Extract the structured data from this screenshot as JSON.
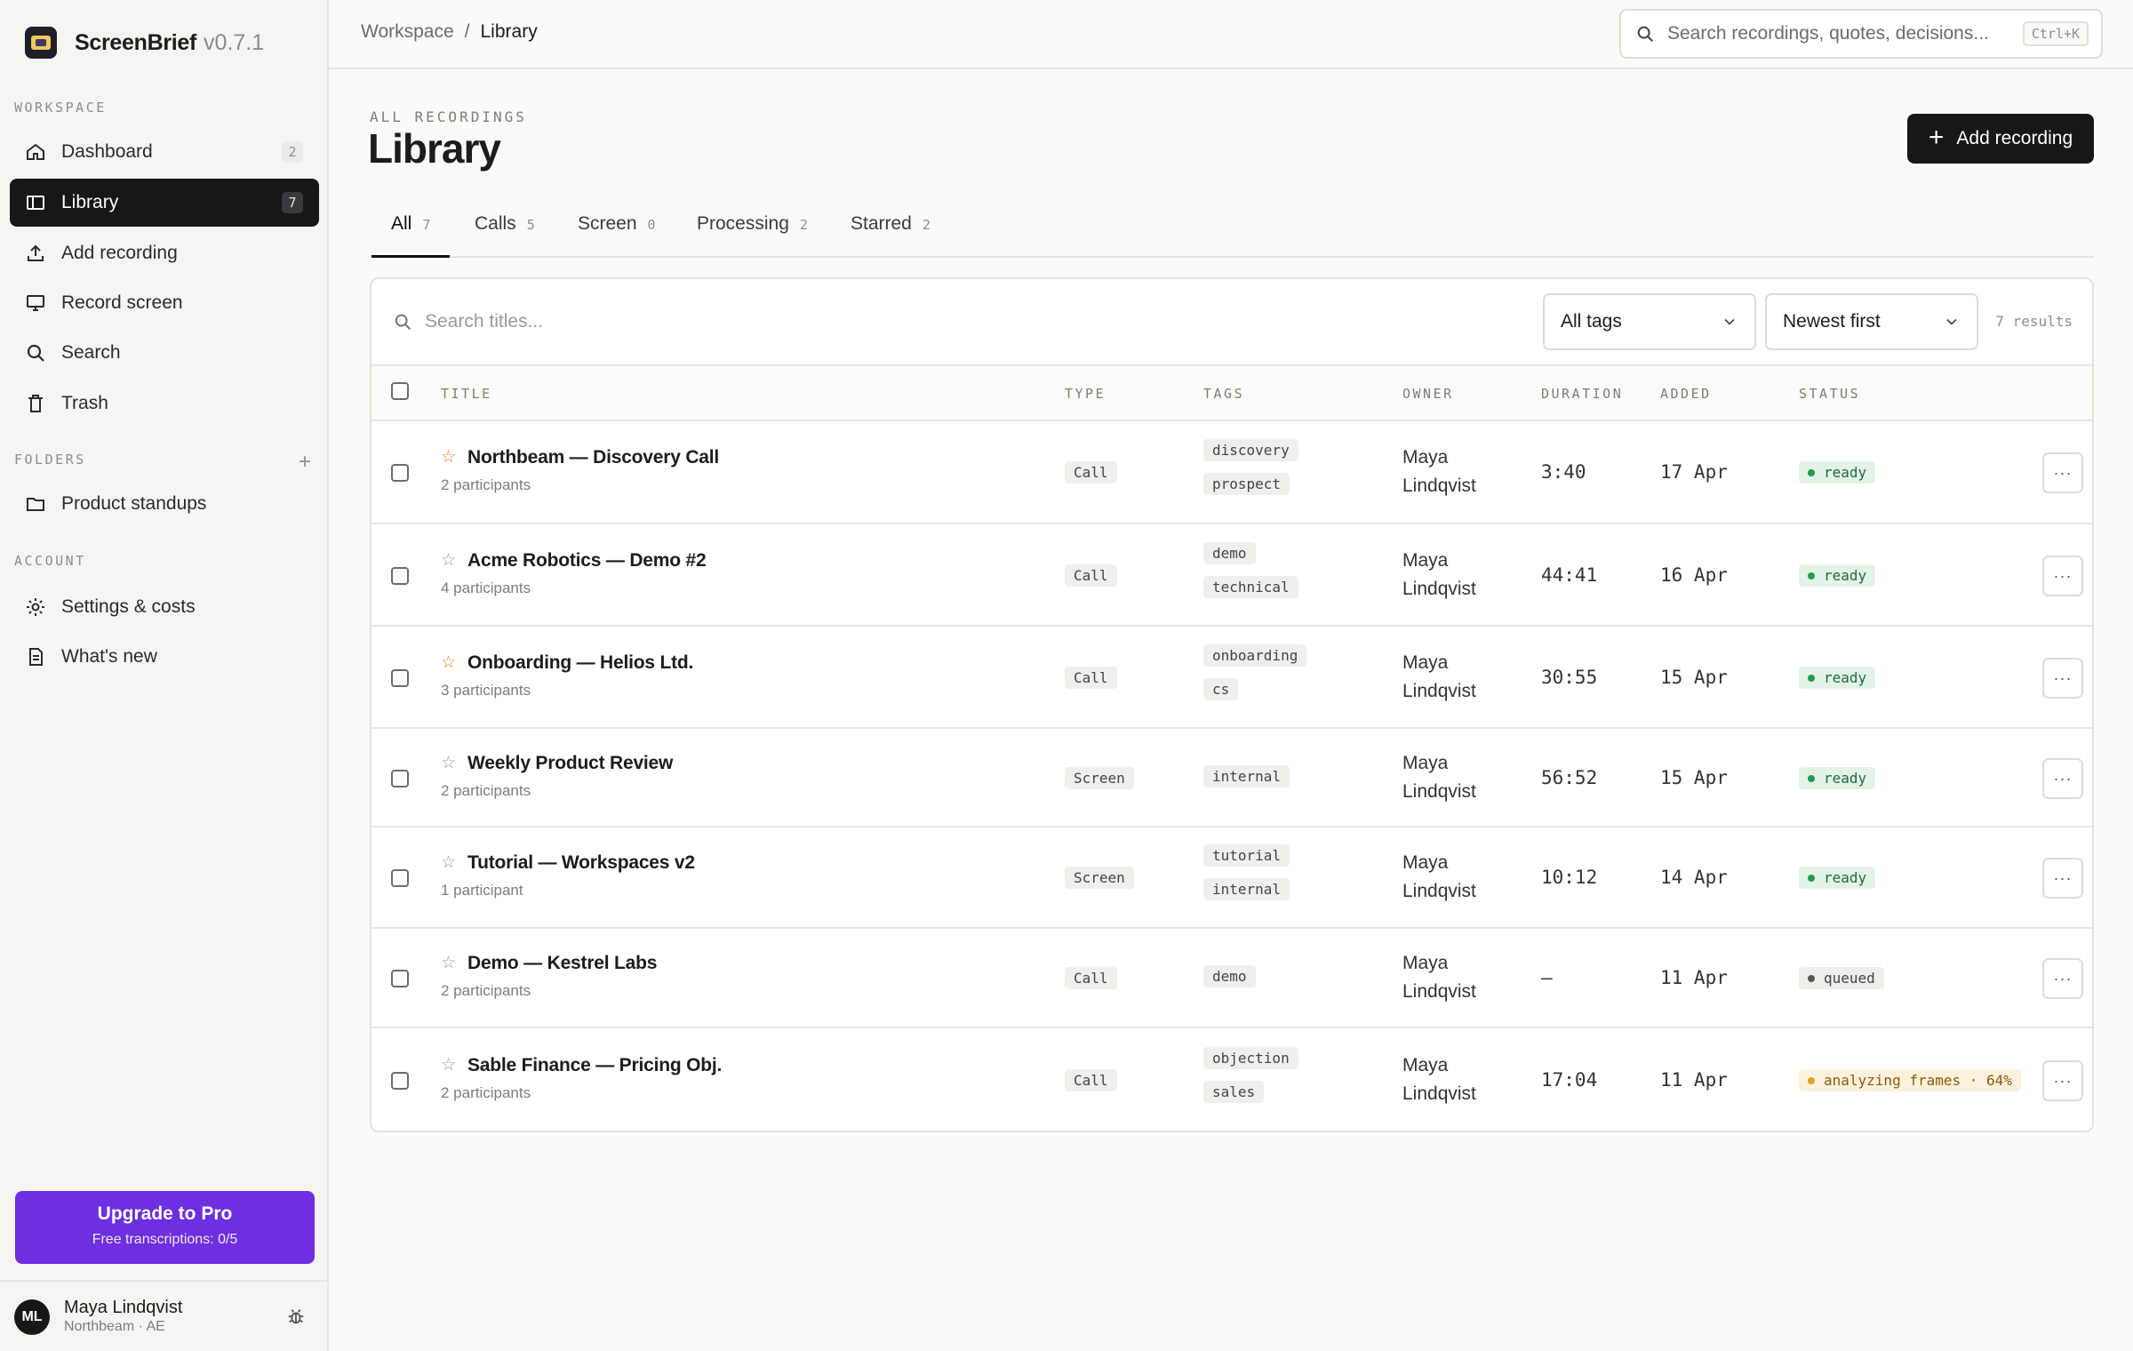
{
  "brand": {
    "name": "ScreenBrief",
    "version": "v0.7.1"
  },
  "sidebar": {
    "workspace_label": "WORKSPACE",
    "items": [
      {
        "label": "Dashboard",
        "count": "2",
        "icon": "home-icon"
      },
      {
        "label": "Library",
        "count": "7",
        "icon": "library-icon",
        "active": true
      },
      {
        "label": "Add recording",
        "icon": "upload-icon"
      },
      {
        "label": "Record screen",
        "icon": "monitor-icon"
      },
      {
        "label": "Search",
        "icon": "search-icon"
      },
      {
        "label": "Trash",
        "icon": "trash-icon"
      }
    ],
    "folders_label": "FOLDERS",
    "folders": [
      {
        "label": "Product standups",
        "icon": "folder-icon"
      }
    ],
    "account_label": "ACCOUNT",
    "account_items": [
      {
        "label": "Settings & costs",
        "icon": "gear-icon"
      },
      {
        "label": "What's new",
        "icon": "document-icon"
      }
    ],
    "upgrade": {
      "title": "Upgrade to Pro",
      "subtitle": "Free transcriptions: 0/5"
    },
    "user": {
      "initials": "ML",
      "name": "Maya Lindqvist",
      "sub": "Northbeam · AE"
    }
  },
  "topbar": {
    "breadcrumb": [
      "Workspace",
      "/",
      "Library"
    ],
    "search_placeholder": "Search recordings, quotes, decisions...",
    "shortcut": "Ctrl+K"
  },
  "header": {
    "eyebrow": "ALL RECORDINGS",
    "title": "Library",
    "add_button": "Add recording"
  },
  "tabs": [
    {
      "label": "All",
      "count": "7",
      "active": true
    },
    {
      "label": "Calls",
      "count": "5"
    },
    {
      "label": "Screen",
      "count": "0"
    },
    {
      "label": "Processing",
      "count": "2"
    },
    {
      "label": "Starred",
      "count": "2"
    }
  ],
  "filters": {
    "search_placeholder": "Search titles...",
    "tag_select": "All tags",
    "sort_select": "Newest first",
    "results": "7 results"
  },
  "columns": [
    "TITLE",
    "TYPE",
    "TAGS",
    "OWNER",
    "DURATION",
    "ADDED",
    "STATUS"
  ],
  "rows": [
    {
      "starred": true,
      "title": "Northbeam — Discovery Call",
      "participants": "2 participants",
      "type": "Call",
      "tags": [
        "discovery",
        "prospect"
      ],
      "owner_first": "Maya",
      "owner_last": "Lindqvist",
      "duration": "3:40",
      "added": "17 Apr",
      "status": "ready",
      "status_kind": "ready"
    },
    {
      "starred": false,
      "title": "Acme Robotics — Demo #2",
      "participants": "4 participants",
      "type": "Call",
      "tags": [
        "demo",
        "technical"
      ],
      "owner_first": "Maya",
      "owner_last": "Lindqvist",
      "duration": "44:41",
      "added": "16 Apr",
      "status": "ready",
      "status_kind": "ready"
    },
    {
      "starred": true,
      "title": "Onboarding — Helios Ltd.",
      "participants": "3 participants",
      "type": "Call",
      "tags": [
        "onboarding",
        "cs"
      ],
      "owner_first": "Maya",
      "owner_last": "Lindqvist",
      "duration": "30:55",
      "added": "15 Apr",
      "status": "ready",
      "status_kind": "ready"
    },
    {
      "starred": false,
      "title": "Weekly Product Review",
      "participants": "2 participants",
      "type": "Screen",
      "tags": [
        "internal"
      ],
      "owner_first": "Maya",
      "owner_last": "Lindqvist",
      "duration": "56:52",
      "added": "15 Apr",
      "status": "ready",
      "status_kind": "ready"
    },
    {
      "starred": false,
      "title": "Tutorial — Workspaces v2",
      "participants": "1 participant",
      "type": "Screen",
      "tags": [
        "tutorial",
        "internal"
      ],
      "owner_first": "Maya",
      "owner_last": "Lindqvist",
      "duration": "10:12",
      "added": "14 Apr",
      "status": "ready",
      "status_kind": "ready"
    },
    {
      "starred": false,
      "title": "Demo — Kestrel Labs",
      "participants": "2 participants",
      "type": "Call",
      "tags": [
        "demo"
      ],
      "owner_first": "Maya",
      "owner_last": "Lindqvist",
      "duration": "—",
      "added": "11 Apr",
      "status": "queued",
      "status_kind": "queued"
    },
    {
      "starred": false,
      "title": "Sable Finance — Pricing Obj.",
      "participants": "2 participants",
      "type": "Call",
      "tags": [
        "objection",
        "sales"
      ],
      "owner_first": "Maya",
      "owner_last": "Lindqvist",
      "duration": "17:04",
      "added": "11 Apr",
      "status": "analyzing frames · 64%",
      "status_kind": "analyzing"
    }
  ],
  "colors": {
    "accent": "#6d2fe0",
    "dark": "#17171a",
    "ready": "#249a4e",
    "analyzing": "#e0a12a"
  }
}
